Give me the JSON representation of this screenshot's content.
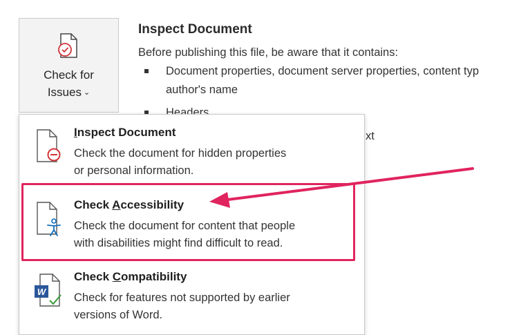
{
  "check_button": {
    "label_line1": "Check for",
    "label_line2": "Issues",
    "icon": "document-check-icon"
  },
  "inspect_panel": {
    "title": "Inspect Document",
    "description": "Before publishing this file, be aware that it contains:",
    "bullets": [
      "Document properties, document server properties, content typ",
      "author's name",
      "Headers"
    ],
    "stray_text": "xt"
  },
  "menu": {
    "items": [
      {
        "title_pre": "",
        "title_accel": "I",
        "title_post": "nspect Document",
        "desc_line1": "Check the document for hidden properties",
        "desc_line2": "or personal information.",
        "icon": "inspect-document-icon"
      },
      {
        "title_pre": "Check ",
        "title_accel": "A",
        "title_post": "ccessibility",
        "desc_line1": "Check the document for content that people",
        "desc_line2": "with disabilities might find difficult to read.",
        "icon": "accessibility-icon"
      },
      {
        "title_pre": "Check ",
        "title_accel": "C",
        "title_post": "ompatibility",
        "desc_line1": "Check for features not supported by earlier",
        "desc_line2": "versions of Word.",
        "icon": "word-compatibility-icon"
      }
    ]
  },
  "colors": {
    "highlight": "#e0245e",
    "word_blue": "#2b579a",
    "accessibility_blue": "#0f6cbd",
    "green_check": "#3a9a3a",
    "red_circle": "#d13438"
  }
}
